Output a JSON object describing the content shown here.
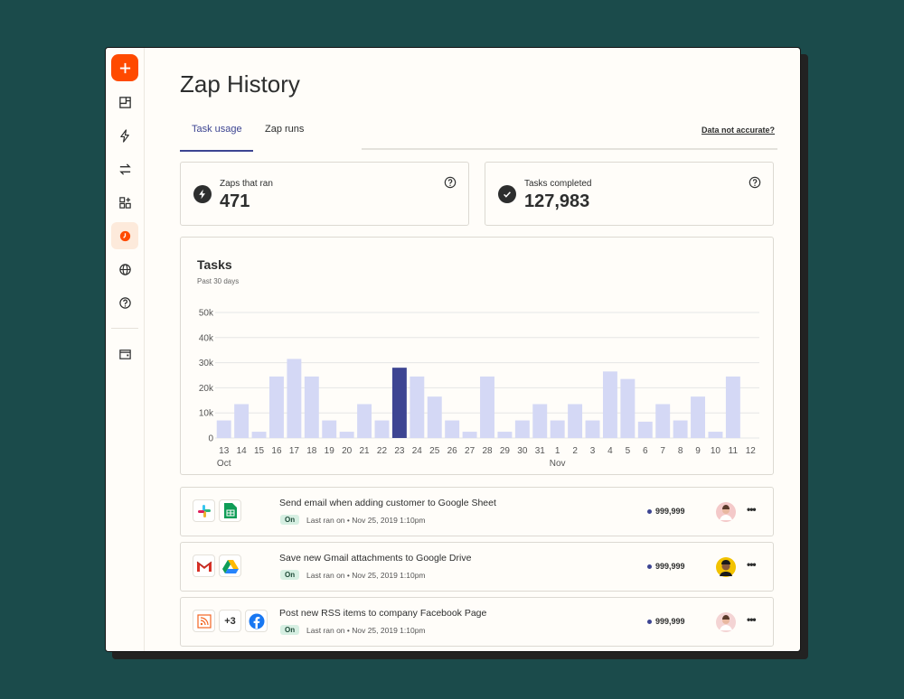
{
  "page": {
    "title": "Zap History"
  },
  "sidebar": {
    "items": [
      {
        "icon": "plus-icon"
      },
      {
        "icon": "dashboard-icon"
      },
      {
        "icon": "bolt-icon"
      },
      {
        "icon": "transfer-icon"
      },
      {
        "icon": "apps-icon"
      },
      {
        "icon": "history-icon",
        "active": true
      },
      {
        "icon": "globe-icon"
      },
      {
        "icon": "help-icon"
      },
      {
        "icon": "wallet-icon"
      }
    ]
  },
  "tabs": [
    {
      "label": "Task usage",
      "active": true
    },
    {
      "label": "Zap runs",
      "active": false
    }
  ],
  "data_link": "Data not accurate?",
  "stats": [
    {
      "label": "Zaps that ran",
      "value": "471",
      "icon": "bolt-icon"
    },
    {
      "label": "Tasks completed",
      "value": "127,983",
      "icon": "check-icon"
    }
  ],
  "chart_data": {
    "type": "bar",
    "title": "Tasks",
    "subtitle": "Past 30 days",
    "categories": [
      "13",
      "14",
      "15",
      "16",
      "17",
      "18",
      "19",
      "20",
      "21",
      "22",
      "23",
      "24",
      "25",
      "26",
      "27",
      "28",
      "29",
      "30",
      "31",
      "1",
      "2",
      "3",
      "4",
      "5",
      "6",
      "7",
      "8",
      "9",
      "10",
      "11",
      "12"
    ],
    "month_labels": [
      {
        "index": 0,
        "label": "Oct"
      },
      {
        "index": 19,
        "label": "Nov"
      }
    ],
    "yticks": [
      "0",
      "10k",
      "20k",
      "30k",
      "40k",
      "50k"
    ],
    "ylim": [
      0,
      50000
    ],
    "values": [
      7000,
      13500,
      2500,
      24500,
      31500,
      24500,
      7000,
      2500,
      13500,
      7000,
      28000,
      24500,
      16500,
      7000,
      2500,
      24500,
      2500,
      7000,
      13500,
      7000,
      13500,
      7000,
      26500,
      23500,
      6500,
      13500,
      7000,
      16500,
      2500,
      24500
    ],
    "highlight_index": 10,
    "colors": {
      "bar": "#d4d8f5",
      "highlight": "#3d4592",
      "grid": "#e6e6e6"
    },
    "grid": true
  },
  "zaps": [
    {
      "name": "Send email when adding customer to Google Sheet",
      "status": "On",
      "last_ran": "Last ran on • Nov 25, 2019 1:10pm",
      "count": "999,999",
      "apps": [
        "slack-icon",
        "google-sheets-icon"
      ]
    },
    {
      "name": "Save new Gmail attachments to Google Drive",
      "status": "On",
      "last_ran": "Last ran on • Nov 25, 2019 1:10pm",
      "count": "999,999",
      "apps": [
        "gmail-icon",
        "google-drive-icon"
      ]
    },
    {
      "name": "Post new RSS items to company Facebook Page",
      "status": "On",
      "last_ran": "Last ran on • Nov 25, 2019 1:10pm",
      "count": "999,999",
      "apps": [
        "rss-icon",
        "facebook-icon"
      ],
      "extra_apps": "+3"
    }
  ],
  "colors": {
    "accent": "#3d4592",
    "brand": "#ff4a00",
    "background": "#1b4b4b"
  }
}
